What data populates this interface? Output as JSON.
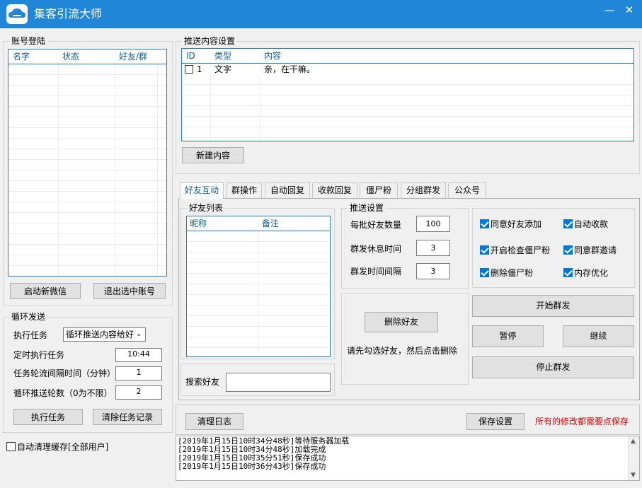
{
  "app": {
    "title": "集客引流大师"
  },
  "window": {
    "minimize": "—",
    "close": "✕"
  },
  "accounts": {
    "title": "账号登陆",
    "columns": [
      "名字",
      "状态",
      "好友/群"
    ],
    "start_button": "启动新微信",
    "logout_button": "退出选中账号"
  },
  "loop": {
    "title": "循环发送",
    "task_label": "执行任务",
    "task_value": "循环推送内容给好",
    "timer_label": "定时执行任务",
    "timer_value": "10:44",
    "interval_label": "任务轮流间隔时间（分钟）",
    "interval_value": "1",
    "rounds_label": "循环推送轮数（0为不限）",
    "rounds_value": "2",
    "run_button": "执行任务",
    "clear_button": "清除任务记录"
  },
  "auto_clear": {
    "label": "自动清理缓存[全部用户]",
    "checked": false
  },
  "push": {
    "title": "推送内容设置",
    "columns": [
      "ID",
      "类型",
      "内容"
    ],
    "rows": [
      {
        "id": "1",
        "type": "文字",
        "content": "亲，在干嘛。",
        "checked": false
      }
    ],
    "new_button": "新建内容"
  },
  "tabs": [
    "好友互动",
    "群操作",
    "自动回复",
    "收款回复",
    "僵尸粉",
    "分组群发",
    "公众号"
  ],
  "friends": {
    "title": "好友列表",
    "columns": [
      "昵称",
      "备注"
    ],
    "search_label": "搜索好友",
    "search_value": ""
  },
  "push_settings": {
    "title": "推送设置",
    "per_batch_label": "每批好友数量",
    "per_batch_value": "100",
    "rest_label": "群发休息时间",
    "rest_value": "3",
    "interval_label": "群发时间间隔",
    "interval_value": "3"
  },
  "delete": {
    "button": "删除好友",
    "hint": "请先勾选好友，然后点击删除"
  },
  "options": [
    {
      "label": "同意好友添加",
      "checked": true
    },
    {
      "label": "自动收款",
      "checked": true
    },
    {
      "label": "开启检查僵尸粉",
      "checked": true
    },
    {
      "label": "同意群邀请",
      "checked": true
    },
    {
      "label": "删除僵尸粉",
      "checked": true
    },
    {
      "label": "内存优化",
      "checked": true
    }
  ],
  "actions": {
    "start": "开始群发",
    "pause": "暂停",
    "resume": "继续",
    "stop": "停止群发"
  },
  "footer": {
    "clear_log": "清理日志",
    "save": "保存设置",
    "warning": "所有的修改都需要点保存"
  },
  "log": [
    "[2019年1月15日10时34分48秒]等待服务器加载",
    "[2019年1月15日10时34分48秒]加载完成",
    "[2019年1月15日10时35分51秒]保存成功",
    "[2019年1月15日10时36分43秒]保存成功"
  ],
  "colors": {
    "titlebar": "#1f86d8",
    "accent": "#0a5f92",
    "warning": "#e00000",
    "check": "#0078d7"
  },
  "icons": {
    "logo": "cloud-logo-icon"
  }
}
